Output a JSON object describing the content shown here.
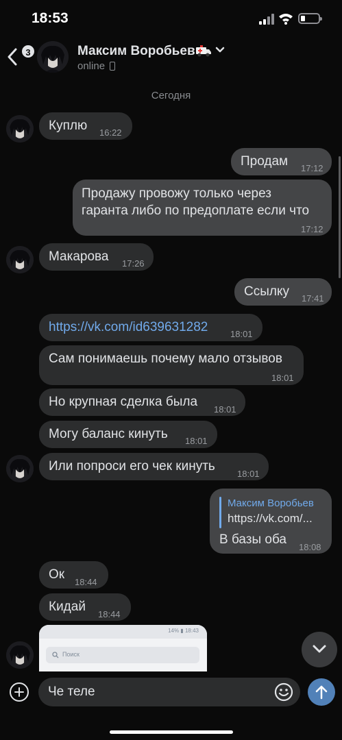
{
  "status_bar": {
    "time": "18:53"
  },
  "header": {
    "back_badge": "3",
    "name": "Максим Воробьев",
    "status": "online",
    "emoji_icon": "ambulance-emoji-icon"
  },
  "chat": {
    "date_separator": "Сегодня",
    "messages": [
      {
        "dir": "in",
        "text": "Куплю",
        "time": "16:22"
      },
      {
        "dir": "out",
        "text": "Продам",
        "time": "17:12"
      },
      {
        "dir": "out",
        "line1": "Продажу провожу только через",
        "line2": "гаранта либо по предоплате если что",
        "time": "17:12"
      },
      {
        "dir": "in",
        "text": "Макарова",
        "time": "17:26"
      },
      {
        "dir": "out",
        "text": "Ссылку",
        "time": "17:41"
      },
      {
        "dir": "in",
        "text": "https://vk.com/id639631282",
        "time": "18:01"
      },
      {
        "dir": "in",
        "text": "Сам понимаешь почему мало отзывов",
        "time": "18:01"
      },
      {
        "dir": "in",
        "text": "Но крупная сделка была",
        "time": "18:01"
      },
      {
        "dir": "in",
        "text": "Могу баланс кинуть",
        "time": "18:01"
      },
      {
        "dir": "in",
        "text": "Или попроси его чек кинуть",
        "time": "18:01"
      },
      {
        "dir": "out",
        "reply_author": "Максим Воробьев",
        "reply_text": "https://vk.com/...",
        "text": "В базы оба",
        "time": "18:08"
      },
      {
        "dir": "in",
        "text": "Ок",
        "time": "18:44"
      },
      {
        "dir": "in",
        "text": "Кидай",
        "time": "18:44"
      }
    ],
    "photo_preview": {
      "status": "14% ▮ 18:43",
      "search_placeholder": "Поиск"
    }
  },
  "composer": {
    "input_value": "Че теле"
  },
  "colors": {
    "link": "#71aaeb",
    "send": "#5181b8",
    "incoming": "#2c2d2e",
    "outgoing": "#444547"
  }
}
